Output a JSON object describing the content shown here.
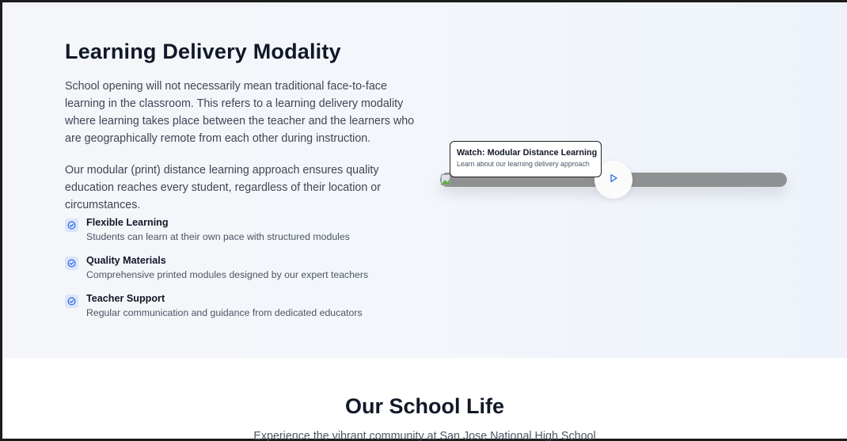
{
  "modality": {
    "heading": "Learning Delivery Modality",
    "paragraph1": "School opening will not necessarily mean traditional face-to-face learning in the classroom. This refers to a learning delivery modality where learning takes place between the teacher and the learners who are geographically remote from each other during instruction.",
    "paragraph2": "Our modular (print) distance learning approach ensures quality education reaches every student, regardless of their location or circumstances.",
    "features": [
      {
        "title": "Flexible Learning",
        "description": "Students can learn at their own pace with structured modules",
        "icon": "check-circle-icon"
      },
      {
        "title": "Quality Materials",
        "description": "Comprehensive printed modules designed by our expert teachers",
        "icon": "check-circle-icon"
      },
      {
        "title": "Teacher Support",
        "description": "Regular communication and guidance from dedicated educators",
        "icon": "check-circle-icon"
      }
    ]
  },
  "video": {
    "tooltip_title": "Watch: Modular Distance Learning",
    "tooltip_subtitle": "Learn about our learning delivery approach",
    "play_icon": "play-icon",
    "image_icon": "broken-image-icon"
  },
  "school_life": {
    "title": "Our School Life",
    "subtitle": "Experience the vibrant community at San Jose National High School"
  },
  "colors": {
    "accent": "#2563eb",
    "heading": "#111827",
    "body_text": "#3f4654",
    "section_bg": "#f3f6fb",
    "video_bar": "#8f9091"
  }
}
